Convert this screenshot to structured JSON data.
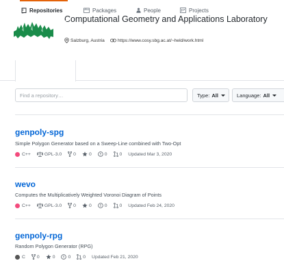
{
  "org": {
    "name": "Computational Geometry and Applications Laboratory",
    "location": "Salzburg, Austria",
    "url": "https://www.cosy.sbg.ac.at/~held/work.html",
    "logo_color": "#1a8c4a"
  },
  "tabs": [
    {
      "label": "Repositories",
      "icon": "repo-icon",
      "selected": true
    },
    {
      "label": "Packages",
      "icon": "package-icon",
      "selected": false
    },
    {
      "label": "People",
      "icon": "person-icon",
      "selected": false
    },
    {
      "label": "Projects",
      "icon": "project-icon",
      "selected": false
    }
  ],
  "filters": {
    "search_placeholder": "Find a repository…",
    "type_label": "Type:",
    "type_value": "All",
    "language_label": "Language:",
    "language_value": "All"
  },
  "colors": {
    "link": "#0366d6",
    "tab_accent": "#e36209",
    "cpp": "#f34b7d",
    "c": "#555555"
  },
  "repos": [
    {
      "name": "genpoly-spg",
      "description": "Simple Polygon Generator based on a Sweep-Line combined with Two-Opt",
      "language": "C++",
      "language_color": "#f34b7d",
      "license": "GPL-3.0",
      "forks": "0",
      "stars": "0",
      "issues": "0",
      "pulls": "0",
      "updated": "Updated Mar 3, 2020"
    },
    {
      "name": "wevo",
      "description": "Computes the Multiplicatively Weighted Voronoi Diagram of Points",
      "language": "C++",
      "language_color": "#f34b7d",
      "license": "GPL-3.0",
      "forks": "0",
      "stars": "0",
      "issues": "0",
      "pulls": "0",
      "updated": "Updated Feb 24, 2020"
    },
    {
      "name": "genpoly-rpg",
      "description": "Random Polygon Generator (RPG)",
      "language": "C",
      "language_color": "#555555",
      "forks": "0",
      "stars": "0",
      "issues": "0",
      "pulls": "0",
      "updated": "Updated Feb 21, 2020"
    }
  ]
}
